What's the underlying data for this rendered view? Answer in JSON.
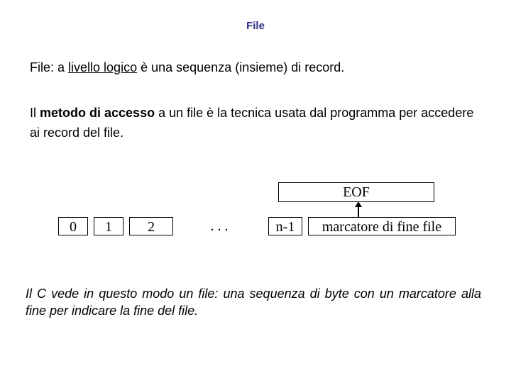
{
  "title": "File",
  "para1": {
    "pre": "File: a ",
    "underlined": "livello logico",
    "post": " è una sequenza (insieme) di record."
  },
  "para2": {
    "pre": "Il ",
    "bold": "metodo di accesso",
    "post": " a un file è la tecnica usata dal programma per accedere ai record del file."
  },
  "diagram": {
    "eof_label": "EOF",
    "cells": [
      "0",
      "1",
      "2",
      ". . .",
      "n-1",
      "marcatore di fine file"
    ]
  },
  "para3": "Il C vede in questo modo un file: una sequenza di byte con un marcatore alla fine per indicare la fine del file."
}
